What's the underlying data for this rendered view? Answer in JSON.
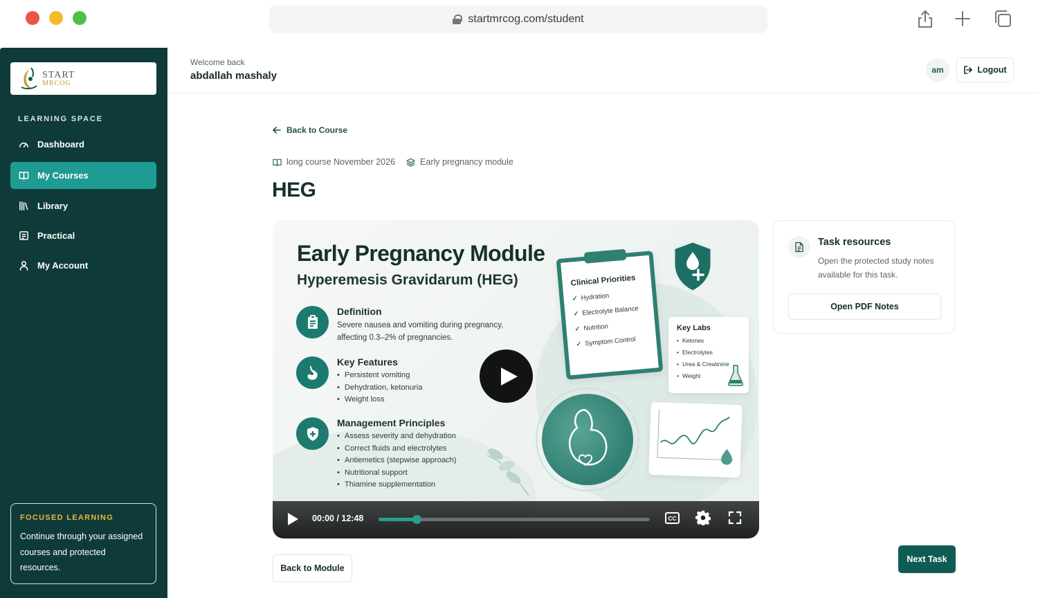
{
  "browser": {
    "url": "startmrcog.com/student"
  },
  "sidebar": {
    "logo_line1": "START",
    "logo_line2": "MRCOG",
    "section_label": "LEARNING SPACE",
    "items": [
      {
        "label": "Dashboard",
        "icon": "gauge-icon",
        "active": false
      },
      {
        "label": "My Courses",
        "icon": "book-open-icon",
        "active": true
      },
      {
        "label": "Library",
        "icon": "library-icon",
        "active": false
      },
      {
        "label": "Practical",
        "icon": "clipboard-list-icon",
        "active": false
      },
      {
        "label": "My Account",
        "icon": "user-icon",
        "active": false
      }
    ],
    "focus_card": {
      "label": "FOCUSED LEARNING",
      "text": "Continue through your assigned courses and protected resources."
    }
  },
  "header": {
    "welcome": "Welcome back",
    "username": "abdallah mashaly",
    "avatar_initials": "am",
    "logout_label": "Logout"
  },
  "main": {
    "back_to_course": "Back to Course",
    "breadcrumb_course": "long course November 2026",
    "breadcrumb_module": "Early pregnancy module",
    "title": "HEG"
  },
  "video": {
    "title": "Early Pregnancy Module",
    "subtitle": "Hyperemesis Gravidarum (HEG)",
    "definition_heading": "Definition",
    "definition_text": "Severe nausea and vomiting during pregnancy, affecting 0.3–2% of pregnancies.",
    "features_heading": "Key Features",
    "features": [
      "Persistent vomiting",
      "Dehydration, ketonuria",
      "Weight loss"
    ],
    "management_heading": "Management Principles",
    "management": [
      "Assess severity and dehydration",
      "Correct fluids and electrolytes",
      "Antiemetics (stepwise approach)",
      "Nutritional support",
      "Thiamine supplementation"
    ],
    "clipboard_heading": "Clinical Priorities",
    "clipboard_items": [
      "Hydration",
      "Electrolyte Balance",
      "Nutrition",
      "Symptom Control"
    ],
    "labs_heading": "Key Labs",
    "labs_items": [
      "Ketones",
      "Electrolytes",
      "Urea & Creatinine",
      "Weight"
    ],
    "time_display": "00:00 / 12:48",
    "progress": 0.14,
    "cc_label": "CC"
  },
  "resources": {
    "title": "Task resources",
    "description": "Open the protected study notes available for this task.",
    "button_label": "Open PDF Notes"
  },
  "footer": {
    "back_to_module": "Back to Module",
    "next_task": "Next Task"
  },
  "colors": {
    "sidebar_bg": "#0e3b39",
    "accent": "#1e9b93",
    "primary_button": "#0f5c55",
    "focus_label": "#f0b43a"
  }
}
